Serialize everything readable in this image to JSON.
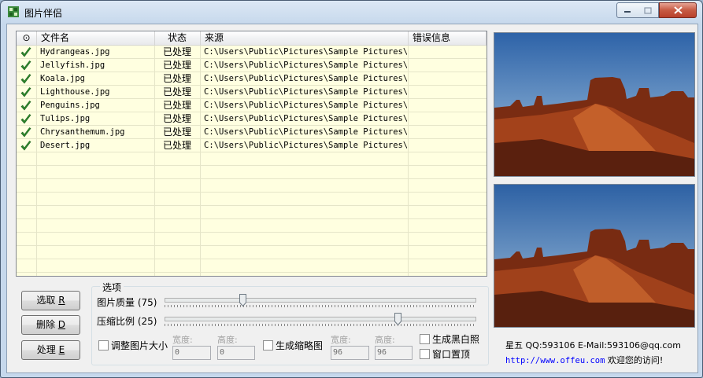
{
  "window": {
    "title": "图片伴侣"
  },
  "list": {
    "columns": [
      "⊙",
      "文件名",
      "状态",
      "来源",
      "错误信息"
    ],
    "rows": [
      {
        "file": "Hydrangeas.jpg",
        "status": "已处理",
        "source": "C:\\Users\\Public\\Pictures\\Sample Pictures\\",
        "error": ""
      },
      {
        "file": "Jellyfish.jpg",
        "status": "已处理",
        "source": "C:\\Users\\Public\\Pictures\\Sample Pictures\\",
        "error": ""
      },
      {
        "file": "Koala.jpg",
        "status": "已处理",
        "source": "C:\\Users\\Public\\Pictures\\Sample Pictures\\",
        "error": ""
      },
      {
        "file": "Lighthouse.jpg",
        "status": "已处理",
        "source": "C:\\Users\\Public\\Pictures\\Sample Pictures\\",
        "error": ""
      },
      {
        "file": "Penguins.jpg",
        "status": "已处理",
        "source": "C:\\Users\\Public\\Pictures\\Sample Pictures\\",
        "error": ""
      },
      {
        "file": "Tulips.jpg",
        "status": "已处理",
        "source": "C:\\Users\\Public\\Pictures\\Sample Pictures\\",
        "error": ""
      },
      {
        "file": "Chrysanthemum.jpg",
        "status": "已处理",
        "source": "C:\\Users\\Public\\Pictures\\Sample Pictures\\",
        "error": ""
      },
      {
        "file": "Desert.jpg",
        "status": "已处理",
        "source": "C:\\Users\\Public\\Pictures\\Sample Pictures\\",
        "error": ""
      }
    ],
    "row_icon": "check-icon"
  },
  "buttons": {
    "select": {
      "label": "选取 ",
      "key": "R"
    },
    "delete": {
      "label": "删除 ",
      "key": "D"
    },
    "process": {
      "label": "处理 ",
      "key": "E"
    }
  },
  "options": {
    "group_label": "选项",
    "quality_label": "图片质量 (75)",
    "quality_value": 75,
    "ratio_label": "压缩比例 (25)",
    "ratio_value": 25,
    "resize_label": "调整图片大小",
    "resize_checked": false,
    "width_label": "宽度:",
    "height_label": "高度:",
    "resize_width": "0",
    "resize_height": "0",
    "thumb_label": "生成缩略图",
    "thumb_checked": false,
    "thumb_width_label": "宽度:",
    "thumb_height_label": "高度:",
    "thumb_width": "96",
    "thumb_height": "96",
    "bw_label": "生成黑白照",
    "bw_checked": false,
    "topmost_label": "窗口置顶",
    "topmost_checked": false
  },
  "status": {
    "author_line": "星五 QQ:593106 E-Mail:593106@qq.com",
    "url": "http://www.offeu.com",
    "welcome": " 欢迎您的访问!"
  },
  "colors": {
    "list_bg": "#ffffe0",
    "link": "#0000ff",
    "accent_close": "#c75a43"
  }
}
